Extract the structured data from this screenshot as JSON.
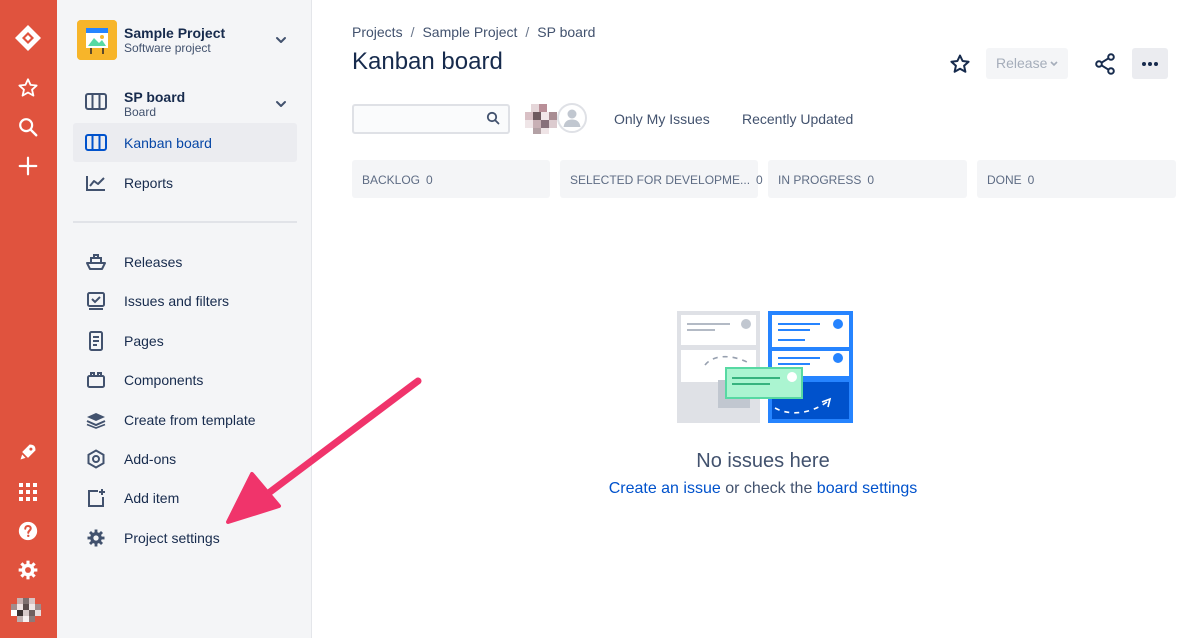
{
  "global_nav": {
    "icons": [
      "jira-logo-icon",
      "star-icon",
      "search-icon",
      "plus-icon",
      "rocket-icon",
      "app-switcher-icon",
      "help-icon",
      "gear-icon",
      "user-avatar"
    ],
    "color": "#e0533e"
  },
  "sidebar": {
    "project_name": "Sample Project",
    "project_type": "Software project",
    "board_name": "SP board",
    "board_type": "Board",
    "items": [
      {
        "label": "Kanban board",
        "icon": "board-icon",
        "active": true
      },
      {
        "label": "Reports",
        "icon": "chart-icon"
      },
      {
        "label": "Releases",
        "icon": "ship-icon"
      },
      {
        "label": "Issues and filters",
        "icon": "filter-icon"
      },
      {
        "label": "Pages",
        "icon": "page-icon"
      },
      {
        "label": "Components",
        "icon": "component-icon"
      },
      {
        "label": "Create from template",
        "icon": "layers-icon"
      },
      {
        "label": "Add-ons",
        "icon": "hexagon-icon"
      },
      {
        "label": "Add item",
        "icon": "add-item-icon"
      },
      {
        "label": "Project settings",
        "icon": "gear-icon"
      }
    ]
  },
  "header": {
    "breadcrumbs": [
      "Projects",
      "Sample Project",
      "SP board"
    ],
    "breadcrumb_separator": "/",
    "title": "Kanban board",
    "release_label": "Release"
  },
  "toolbar": {
    "search_value": "",
    "filters": [
      "Only My Issues",
      "Recently Updated"
    ]
  },
  "columns": [
    {
      "name": "BACKLOG",
      "count": "0"
    },
    {
      "name": "SELECTED FOR DEVELOPME...",
      "count": "0"
    },
    {
      "name": "IN PROGRESS",
      "count": "0"
    },
    {
      "name": "DONE",
      "count": "0"
    }
  ],
  "empty_state": {
    "title": "No issues here",
    "prefix": "",
    "link1": "Create an issue",
    "middle": " or check the ",
    "link2": "board settings"
  },
  "colors": {
    "accent": "#0052cc",
    "annotation_arrow": "#f0346b"
  }
}
